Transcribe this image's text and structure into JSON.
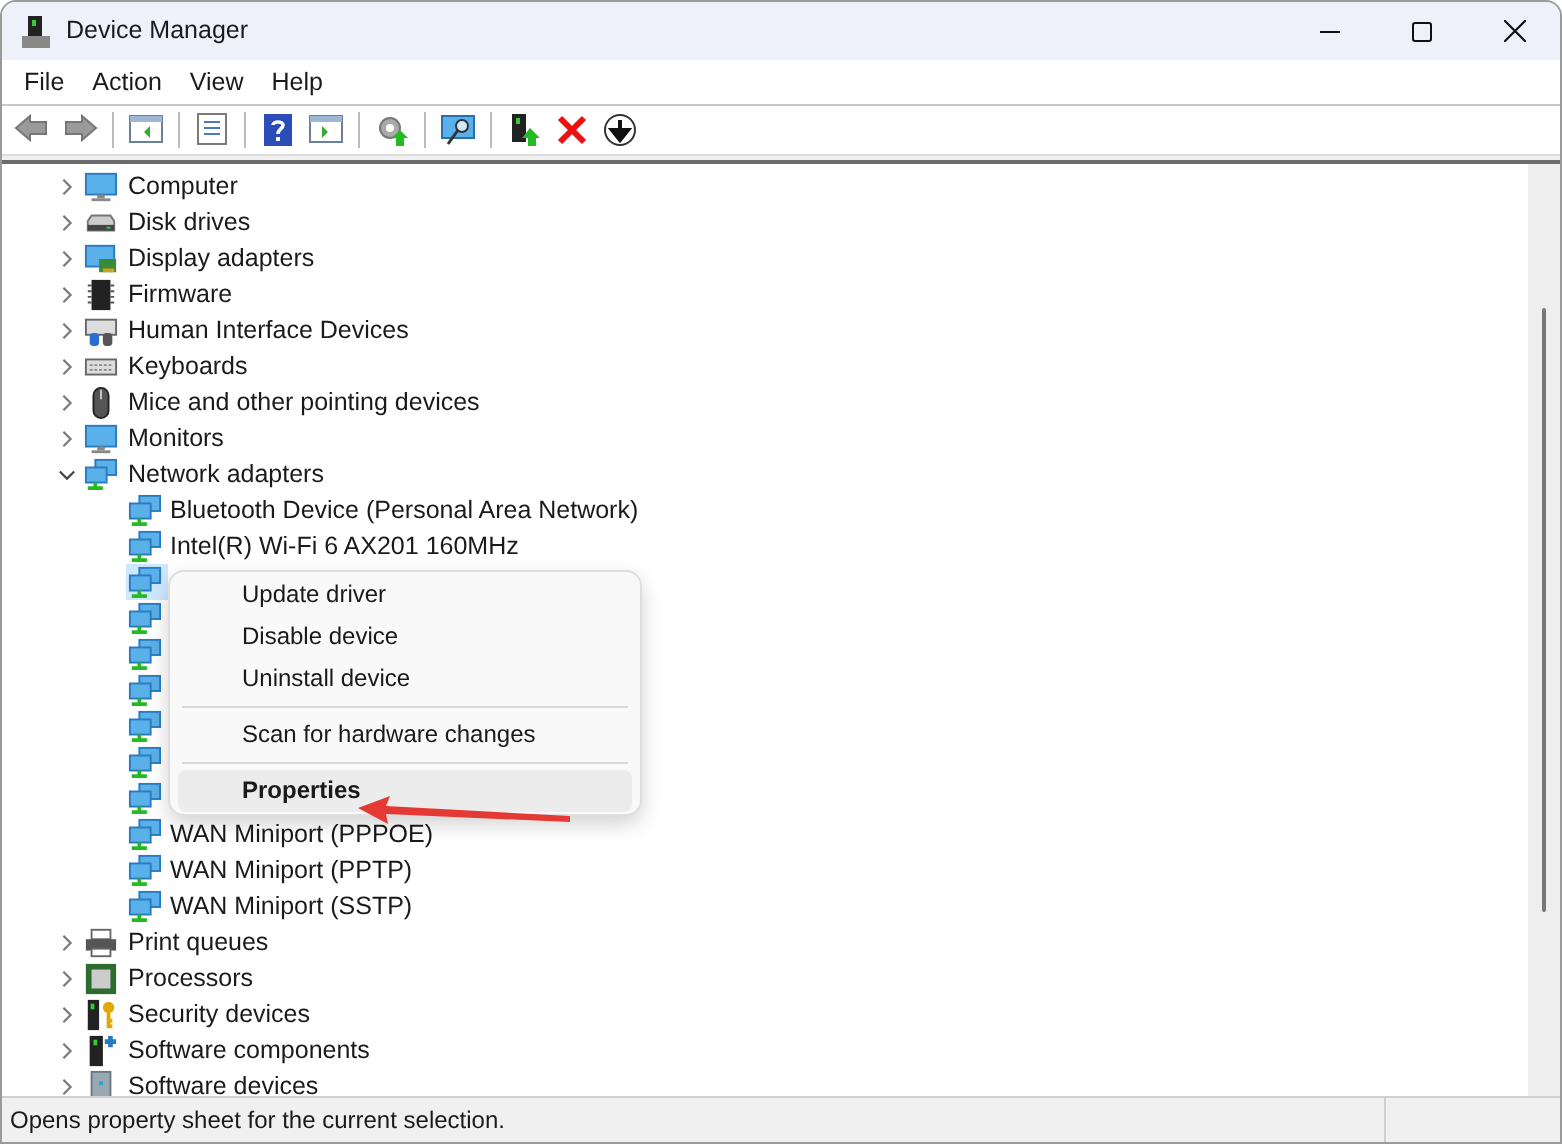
{
  "window": {
    "title": "Device Manager"
  },
  "menu": [
    "File",
    "Action",
    "View",
    "Help"
  ],
  "toolbar": [
    {
      "kind": "back"
    },
    {
      "kind": "forward"
    },
    {
      "kind": "sep"
    },
    {
      "kind": "tree"
    },
    {
      "kind": "sep"
    },
    {
      "kind": "sheet"
    },
    {
      "kind": "sep"
    },
    {
      "kind": "help"
    },
    {
      "kind": "pane"
    },
    {
      "kind": "sep"
    },
    {
      "kind": "gear-update"
    },
    {
      "kind": "sep"
    },
    {
      "kind": "scan"
    },
    {
      "kind": "sep"
    },
    {
      "kind": "update"
    },
    {
      "kind": "remove"
    },
    {
      "kind": "down"
    }
  ],
  "tree": [
    {
      "label": "Computer",
      "kind": "monitor",
      "expanded": false
    },
    {
      "label": "Disk drives",
      "kind": "disk",
      "expanded": false
    },
    {
      "label": "Display adapters",
      "kind": "display",
      "expanded": false
    },
    {
      "label": "Firmware",
      "kind": "chip",
      "expanded": false
    },
    {
      "label": "Human Interface Devices",
      "kind": "hid",
      "expanded": false
    },
    {
      "label": "Keyboards",
      "kind": "keyboard",
      "expanded": false
    },
    {
      "label": "Mice and other pointing devices",
      "kind": "mouse",
      "expanded": false
    },
    {
      "label": "Monitors",
      "kind": "monitor",
      "expanded": false
    },
    {
      "label": "Network adapters",
      "kind": "network",
      "expanded": true,
      "children": [
        {
          "label": "Bluetooth Device (Personal Area Network)",
          "selected": false
        },
        {
          "label": "Intel(R) Wi-Fi 6 AX201 160MHz",
          "selected": false
        },
        {
          "selected": true
        },
        {
          "selected": false
        },
        {
          "selected": false
        },
        {
          "selected": false
        },
        {
          "selected": false
        },
        {
          "selected": false
        },
        {
          "selected": false
        },
        {
          "label": "WAN Miniport (PPPOE)",
          "selected": false
        },
        {
          "label": "WAN Miniport (PPTP)",
          "selected": false
        },
        {
          "label": "WAN Miniport (SSTP)",
          "selected": false
        }
      ]
    },
    {
      "label": "Print queues",
      "kind": "printer",
      "expanded": false
    },
    {
      "label": "Processors",
      "kind": "cpu",
      "expanded": false
    },
    {
      "label": "Security devices",
      "kind": "security",
      "expanded": false
    },
    {
      "label": "Software components",
      "kind": "component",
      "expanded": false
    },
    {
      "label": "Software devices",
      "kind": "softdev",
      "expanded": false
    }
  ],
  "context_menu": {
    "items": [
      {
        "kind": "item",
        "label": "Update driver",
        "highlighted": false,
        "default": false
      },
      {
        "kind": "item",
        "label": "Disable device",
        "highlighted": false,
        "default": false
      },
      {
        "kind": "item",
        "label": "Uninstall device",
        "highlighted": false,
        "default": false
      },
      {
        "kind": "separator"
      },
      {
        "kind": "item",
        "label": "Scan for hardware changes",
        "highlighted": false,
        "default": false
      },
      {
        "kind": "separator"
      },
      {
        "kind": "item",
        "label": "Properties",
        "highlighted": true,
        "default": true
      }
    ]
  },
  "status_bar": {
    "text": "Opens property sheet for the current selection."
  }
}
